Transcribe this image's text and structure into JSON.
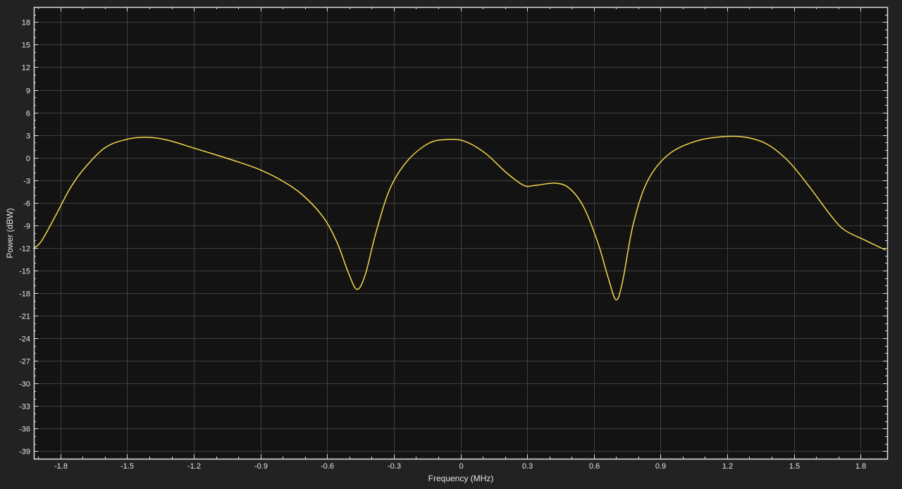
{
  "chart_data": {
    "type": "line",
    "title": "",
    "xlabel": "Frequency (MHz)",
    "ylabel": "Power (dBW)",
    "xlim": [
      -1.92,
      1.92
    ],
    "ylim": [
      -40,
      20
    ],
    "xticks": [
      -1.8,
      -1.5,
      -1.2,
      -0.9,
      -0.6,
      -0.3,
      0,
      0.3,
      0.6,
      0.9,
      1.2,
      1.5,
      1.8
    ],
    "xtick_labels": [
      "-1.8",
      "-1.5",
      "-1.2",
      "-0.9",
      "-0.6",
      "-0.3",
      "0",
      "0.3",
      "0.6",
      "0.9",
      "1.2",
      "1.5",
      "1.8"
    ],
    "yticks": [
      18,
      15,
      12,
      9,
      6,
      3,
      0,
      -3,
      -6,
      -9,
      -12,
      -15,
      -18,
      -21,
      -24,
      -27,
      -30,
      -33,
      -36,
      -39
    ],
    "ytick_labels": [
      "18",
      "15",
      "12",
      "9",
      "6",
      "3",
      "0",
      "-3",
      "-6",
      "-9",
      "-12",
      "-15",
      "-18",
      "-21",
      "-24",
      "-27",
      "-30",
      "-33",
      "-36",
      "-39"
    ],
    "grid": true,
    "colors": {
      "background": "#222222",
      "axes": "#131313",
      "grid": "#404040",
      "line": "#f2d84b",
      "text": "#e6e6e6"
    },
    "series": [
      {
        "name": "Power",
        "x": [
          -1.923,
          -1.886,
          -1.82,
          -1.757,
          -1.695,
          -1.6,
          -1.505,
          -1.41,
          -1.315,
          -1.204,
          -1.093,
          -0.998,
          -0.903,
          -0.808,
          -0.713,
          -0.618,
          -0.555,
          -0.507,
          -0.466,
          -0.428,
          -0.38,
          -0.317,
          -0.238,
          -0.143,
          -0.063,
          0.016,
          0.111,
          0.206,
          0.285,
          0.333,
          0.428,
          0.491,
          0.555,
          0.618,
          0.665,
          0.7,
          0.729,
          0.776,
          0.84,
          0.935,
          1.061,
          1.188,
          1.283,
          1.378,
          1.473,
          1.568,
          1.664,
          1.727,
          1.822,
          1.914
        ],
        "y": [
          -12.1,
          -11.1,
          -7.6,
          -4.1,
          -1.5,
          1.3,
          2.4,
          2.7,
          2.3,
          1.3,
          0.3,
          -0.6,
          -1.6,
          -3.0,
          -4.9,
          -7.9,
          -11.3,
          -15.1,
          -17.5,
          -15.5,
          -9.9,
          -4.1,
          -0.4,
          1.9,
          2.4,
          2.2,
          0.6,
          -2.0,
          -3.7,
          -3.7,
          -3.4,
          -4.1,
          -6.6,
          -11.3,
          -16.0,
          -18.9,
          -16.5,
          -9.0,
          -3.2,
          0.4,
          2.2,
          2.8,
          2.7,
          1.8,
          -0.4,
          -3.8,
          -7.6,
          -9.6,
          -11.0,
          -12.3
        ]
      }
    ]
  }
}
